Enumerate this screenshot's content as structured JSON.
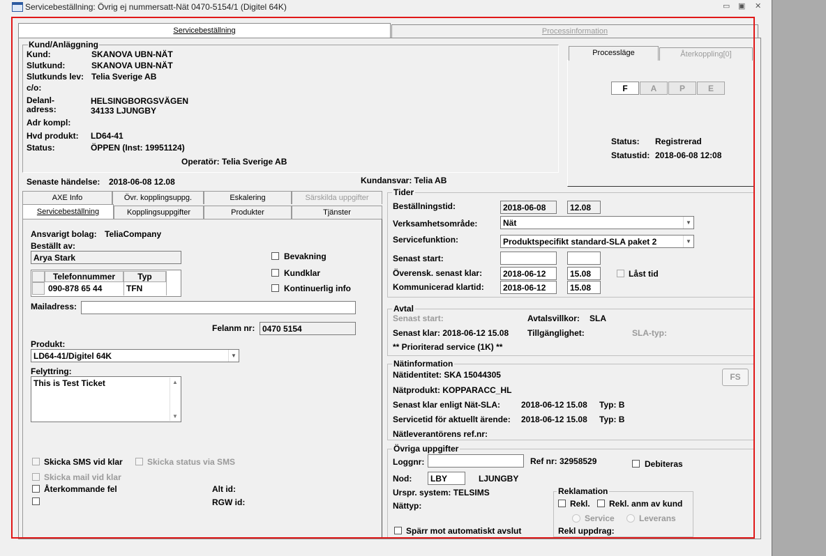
{
  "window": {
    "title": "Servicebeställning: Övrig ej nummersatt-Nät 0470-5154/1  (Digitel 64K)"
  },
  "main_tabs": {
    "servicebestallning": "Servicebeställning",
    "processinformation": "Processinformation"
  },
  "kund": {
    "group_title": "Kund/Anläggning",
    "kund_label": "Kund:",
    "kund_value": "SKANOVA UBN-NÄT",
    "slutkund_label": "Slutkund:",
    "slutkund_value": "SKANOVA UBN-NÄT",
    "slutkundslev_label": "Slutkunds lev:",
    "slutkundslev_value": "Telia Sverige AB",
    "co_label": "c/o:",
    "delanl_label1": "Delanl-",
    "delanl_label2": "adress:",
    "address_line1": "HELSINGBORGSVÄGEN",
    "address_line2": "34133   LJUNGBY",
    "adrkompl_label": "Adr kompl:",
    "hvdprodukt_label": "Hvd produkt:",
    "hvdprodukt_value": "LD64-41",
    "status_label": "Status:",
    "status_value": "ÖPPEN (Inst: 19951124)",
    "operator": "Operatör: Telia Sverige AB"
  },
  "process": {
    "tab_processlage": "Processläge",
    "tab_aterkoppling": "Återkoppling[0]",
    "steps": [
      "F",
      "A",
      "P",
      "E"
    ],
    "status_label": "Status:",
    "status_value": "Registrerad",
    "statustid_label": "Statustid:",
    "statustid_value": "2018-06-08 12:08"
  },
  "senaste": {
    "label": "Senaste händelse:",
    "value": "2018-06-08 12.08",
    "kundansvar": "Kundansvar: Telia AB"
  },
  "sub_tabs": {
    "row1": [
      "AXE Info",
      "Övr. kopplingsuppg.",
      "Eskalering",
      "Särskilda uppgifter"
    ],
    "row2": [
      "Servicebeställning",
      "Kopplingsuppgifter",
      "Produkter",
      "Tjänster"
    ]
  },
  "order": {
    "ansvarigt_label": "Ansvarigt bolag:",
    "ansvarigt_value": "TeliaCompany",
    "bestallt_label": "Beställt av:",
    "bestallt_value": "Arya Stark",
    "bevakning": "Bevakning",
    "kundklar": "Kundklar",
    "kontinuerlig": "Kontinuerlig info",
    "phone_headers": [
      "Telefonnummer",
      "Typ"
    ],
    "phone_rows": [
      {
        "number": "090-878 65 44",
        "type": "TFN"
      }
    ],
    "mail_label": "Mailadress:",
    "mail_value": "",
    "felanm_label": "Felanm nr:",
    "felanm_value": "0470 5154",
    "produkt_label": "Produkt:",
    "produkt_value": "LD64-41/Digitel 64K",
    "felyttring_label": "Felyttring:",
    "felyttring_value": "This is Test Ticket",
    "sms_klar": "Skicka SMS vid klar",
    "status_sms": "Skicka status via SMS",
    "mail_klar": "Skicka mail vid klar",
    "aterkommande": "Återkommande fel",
    "altid_label": "Alt id:",
    "rgwid_label": "RGW id:"
  },
  "tider": {
    "group_title": "Tider",
    "bestallningstid_label": "Beställningstid:",
    "bestallningstid_date": "2018-06-08",
    "bestallningstid_time": "12.08",
    "verksamhet_label": "Verksamhetsområde:",
    "verksamhet_value": "Nät",
    "servicefunktion_label": "Servicefunktion:",
    "servicefunktion_value": "Produktspecifikt standard-SLA paket 2",
    "senast_start_label": "Senast start:",
    "overensk_label": "Överensk. senast klar:",
    "overensk_date": "2018-06-12",
    "overensk_time": "15.08",
    "last_tid": "Låst tid",
    "kommunicerad_label": "Kommunicerad klartid:",
    "kommunicerad_date": "2018-06-12",
    "kommunicerad_time": "15.08"
  },
  "avtal": {
    "group_title": "Avtal",
    "senast_start_label": "Senast start:",
    "avtalsvillkor_label": "Avtalsvillkor:",
    "avtalsvillkor_value": "SLA",
    "senast_klar": "Senast klar:  2018-06-12 15.08",
    "tillganglighet_label": "Tillgänglighet:",
    "slatyp_label": "SLA-typ:",
    "prioriterad": "** Prioriterad service (1K) **"
  },
  "natinfo": {
    "group_title": "Nätinformation",
    "natidentitet": "Nätidentitet:  SKA 15044305",
    "natprodukt": "Nätprodukt:  KOPPARACC_HL",
    "fs_button": "FS",
    "sla_label": "Senast klar enligt Nät-SLA:",
    "sla_value": "2018-06-12 15.08",
    "sla_typ": "Typ:  B",
    "servicetid_label": "Servicetid för aktuellt ärende:",
    "servicetid_value": "2018-06-12 15.08",
    "servicetid_typ": "Typ:  B",
    "natlev_label": "Nätleverantörens ref.nr:"
  },
  "ovriga": {
    "group_title": "Övriga uppgifter",
    "loggnr_label": "Loggnr:",
    "loggnr_value": "",
    "refnr": "Ref nr:  32958529",
    "debiteras": "Debiteras",
    "nod_label": "Nod:",
    "nod_value": "LBY",
    "nod_name": "LJUNGBY",
    "urspr": "Urspr. system:  TELSIMS",
    "nattyp_label": "Nättyp:",
    "spar": "Spärr mot automatiskt avslut",
    "reklamation_title": "Reklamation",
    "rekl": "Rekl.",
    "rekl_anm": "Rekl. anm av kund",
    "service": "Service",
    "leverans": "Leverans",
    "rekl_uppdrag": "Rekl uppdrag:"
  }
}
